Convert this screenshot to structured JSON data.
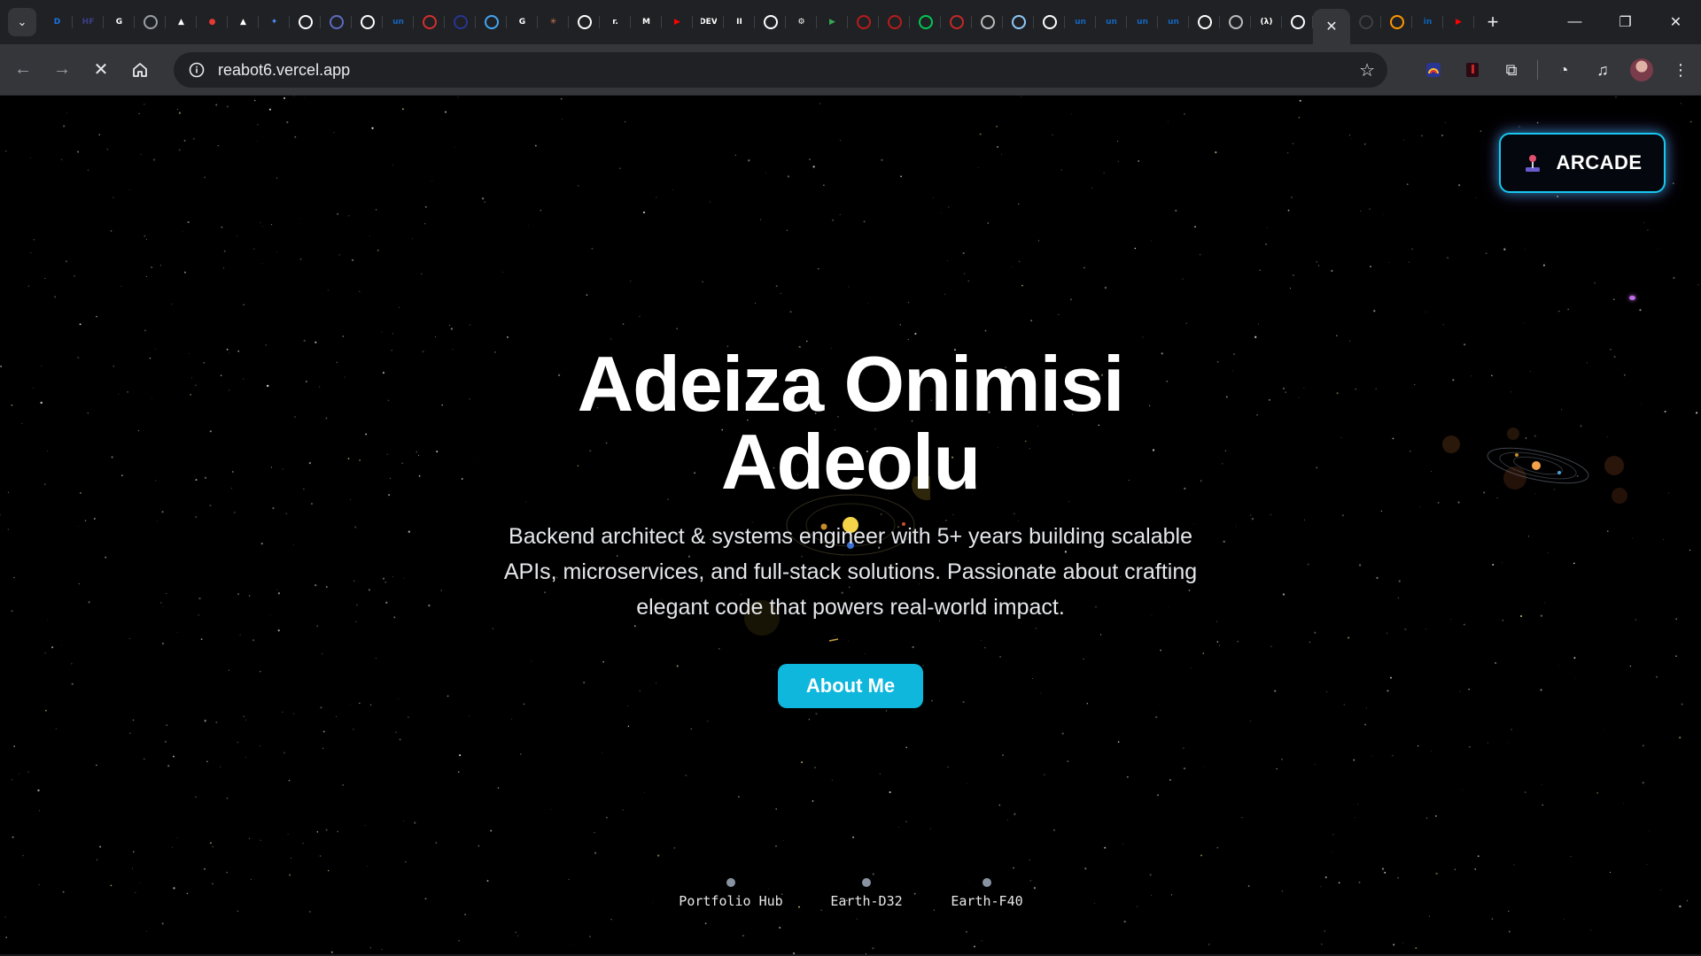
{
  "browser": {
    "tabs": [
      {
        "icon": "tab-search-icon",
        "label": ""
      },
      {
        "icon": "dashboard-icon",
        "label": "D",
        "color": "#1a73e8"
      },
      {
        "icon": "huggingface-icon",
        "label": "HF",
        "color": "#3b3f88"
      },
      {
        "icon": "google-icon",
        "label": "G",
        "color": "#ffffff"
      },
      {
        "icon": "globe-icon",
        "label": "",
        "color": "#9aa0a6"
      },
      {
        "icon": "triangle-icon",
        "label": "▲",
        "color": "#ffffff"
      },
      {
        "icon": "record-icon",
        "label": "●",
        "color": "#e53935"
      },
      {
        "icon": "triangle-icon",
        "label": "▲",
        "color": "#ffffff"
      },
      {
        "icon": "gemini-icon",
        "label": "✦",
        "color": "#4f8cff"
      },
      {
        "icon": "github-icon",
        "label": "",
        "color": "#ffffff"
      },
      {
        "icon": "swirl-icon",
        "label": "",
        "color": "#5c6bc0"
      },
      {
        "icon": "github-icon",
        "label": "",
        "color": "#ffffff"
      },
      {
        "icon": "unstop-icon",
        "label": "un",
        "color": "#1565c0"
      },
      {
        "icon": "bird-icon",
        "label": "",
        "color": "#d32f2f"
      },
      {
        "icon": "circle-dot-icon",
        "label": "",
        "color": "#283593"
      },
      {
        "icon": "dots-icon",
        "label": "",
        "color": "#42a5f5"
      },
      {
        "icon": "google-icon",
        "label": "G",
        "color": "#ffffff"
      },
      {
        "icon": "claude-icon",
        "label": "✳",
        "color": "#d97757"
      },
      {
        "icon": "github-icon",
        "label": "",
        "color": "#ffffff"
      },
      {
        "icon": "render-icon",
        "label": "r.",
        "color": "#ffffff"
      },
      {
        "icon": "medium-icon",
        "label": "M",
        "color": "#ffffff"
      },
      {
        "icon": "youtube-icon",
        "label": "▶",
        "color": "#ff0000"
      },
      {
        "icon": "dev-icon",
        "label": "DEV",
        "color": "#ffffff"
      },
      {
        "icon": "pause-icon",
        "label": "II",
        "color": "#ffffff"
      },
      {
        "icon": "github-icon",
        "label": "",
        "color": "#ffffff"
      },
      {
        "icon": "gear-icon",
        "label": "⚙",
        "color": "#ffffff"
      },
      {
        "icon": "play-store-icon",
        "label": "▶",
        "color": "#34a853"
      },
      {
        "icon": "flame-icon",
        "label": "",
        "color": "#b71c1c"
      },
      {
        "icon": "flame-icon",
        "label": "",
        "color": "#b71c1c"
      },
      {
        "icon": "shield-icon",
        "label": "",
        "color": "#00c853"
      },
      {
        "icon": "boxes-icon",
        "label": "",
        "color": "#c62828"
      },
      {
        "icon": "database-icon",
        "label": "",
        "color": "#bdbdbd"
      },
      {
        "icon": "cursor-icon",
        "label": "",
        "color": "#90caf9"
      },
      {
        "icon": "ghost-icon",
        "label": "",
        "color": "#ffffff"
      },
      {
        "icon": "unstop-icon",
        "label": "un",
        "color": "#1565c0"
      },
      {
        "icon": "unstop-icon",
        "label": "un",
        "color": "#1565c0"
      },
      {
        "icon": "unstop-icon",
        "label": "un",
        "color": "#1565c0"
      },
      {
        "icon": "unstop-icon",
        "label": "un",
        "color": "#1565c0"
      },
      {
        "icon": "openai-icon",
        "label": "",
        "color": "#ffffff"
      },
      {
        "icon": "database-icon",
        "label": "",
        "color": "#bdbdbd"
      },
      {
        "icon": "lambda-icon",
        "label": "(λ)",
        "color": "#ffffff"
      },
      {
        "icon": "vercel-icon",
        "label": "",
        "color": "#ffffff"
      }
    ],
    "active_tab_icon": "close-icon",
    "trailing_tabs": [
      {
        "icon": "github-icon",
        "label": "",
        "color": "#3c4043"
      },
      {
        "icon": "chart-icon",
        "label": "",
        "color": "#ff9800"
      },
      {
        "icon": "linkedin-icon",
        "label": "in",
        "color": "#0a66c2"
      },
      {
        "icon": "youtube-icon",
        "label": "▶",
        "color": "#ff0000"
      }
    ],
    "url": "reabot6.vercel.app"
  },
  "page": {
    "arcade_label": "ARCADE",
    "title_line1": "Adeiza Onimisi",
    "title_line2": "Adeolu",
    "description": "Backend architect & systems engineer with 5+ years building scalable APIs, microservices, and full-stack solutions. Passionate about crafting elegant code that powers real-world impact.",
    "about_label": "About Me",
    "worlds": [
      {
        "label": "Portfolio Hub"
      },
      {
        "label": "Earth-D32"
      },
      {
        "label": "Earth-F40"
      }
    ],
    "accent_color": "#0fb7dc"
  }
}
